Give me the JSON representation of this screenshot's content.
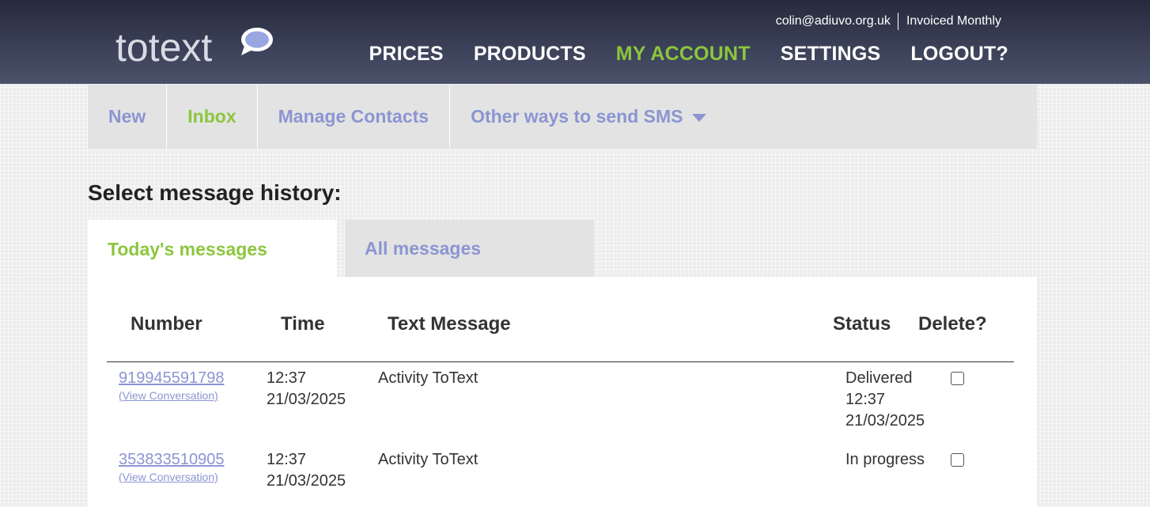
{
  "brand": {
    "logo_text": "totext"
  },
  "userbar": {
    "email": "colin@adiuvo.org.uk",
    "billing": "Invoiced Monthly"
  },
  "main_nav": {
    "prices": "PRICES",
    "products": "PRODUCTS",
    "my_account": "MY ACCOUNT",
    "settings": "SETTINGS",
    "logout": "LOGOUT?",
    "active": "MY ACCOUNT"
  },
  "sub_nav": {
    "new": "New",
    "inbox": "Inbox",
    "manage_contacts": "Manage Contacts",
    "other_ways": "Other ways to send SMS",
    "active": "Inbox"
  },
  "history": {
    "title": "Select message history:",
    "tabs": {
      "today": "Today's messages",
      "all": "All messages",
      "active": "Today's messages"
    }
  },
  "table": {
    "columns": {
      "number": "Number",
      "time": "Time",
      "message": "Text Message",
      "status": "Status",
      "delete": "Delete?"
    },
    "rows": [
      {
        "number": "919945591798",
        "view_link": "(View Conversation)",
        "time_line1": "12:37",
        "time_line2": "21/03/2025",
        "message": "Activity ToText",
        "status_line1": "Delivered",
        "status_line2": "12:37",
        "status_line3": "21/03/2025",
        "delete_checked": false
      },
      {
        "number": "353833510905",
        "view_link": "(View Conversation)",
        "time_line1": "12:37",
        "time_line2": "21/03/2025",
        "message": "Activity ToText",
        "status_line1": "In progress",
        "status_line2": "",
        "status_line3": "",
        "delete_checked": false
      }
    ]
  },
  "colors": {
    "accent_green": "#8cc63e",
    "link_blue": "#8b95d2",
    "header_dark": "#262a3d"
  },
  "icons": {
    "logo_bubble": "speech-bubble-icon",
    "dropdown": "caret-down-icon",
    "checkbox": "checkbox-icon"
  }
}
